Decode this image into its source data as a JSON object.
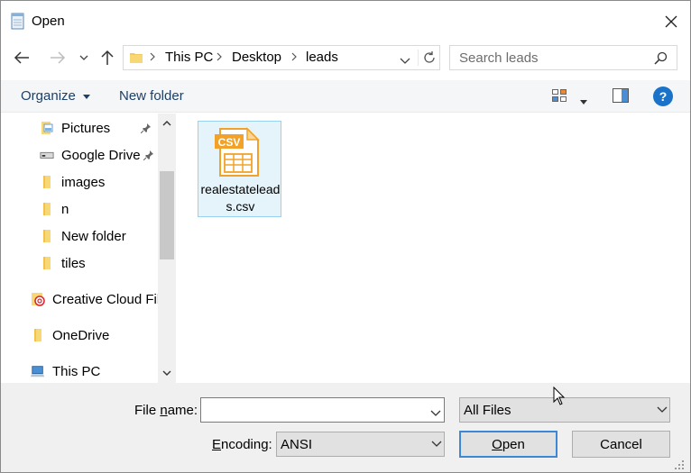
{
  "window": {
    "title": "Open"
  },
  "nav": {
    "breadcrumbs": [
      "This PC",
      "Desktop",
      "leads"
    ],
    "search_placeholder": "Search leads"
  },
  "toolbar": {
    "organize": "Organize",
    "new_folder": "New folder",
    "help": "?"
  },
  "tree": [
    {
      "label": "Pictures",
      "icon": "pictures-folder-icon",
      "pinned": true
    },
    {
      "label": "Google Drive",
      "icon": "drive-icon",
      "pinned": true
    },
    {
      "label": "images",
      "icon": "folder-icon"
    },
    {
      "label": "n",
      "icon": "folder-icon"
    },
    {
      "label": "New folder",
      "icon": "folder-icon"
    },
    {
      "label": "tiles",
      "icon": "folder-icon"
    },
    {
      "label": "Creative Cloud Files",
      "icon": "creative-cloud-icon"
    },
    {
      "label": "OneDrive",
      "icon": "folder-icon"
    },
    {
      "label": "This PC",
      "icon": "computer-icon"
    }
  ],
  "files": [
    {
      "name": "realestateleads.csv",
      "icon_text": "CSV",
      "icon": "csv-file-icon",
      "selected": true
    }
  ],
  "bottom": {
    "file_name_label_pre": "File ",
    "file_name_label_u": "n",
    "file_name_label_post": "ame:",
    "file_name_value": "",
    "file_type": "All Files",
    "encoding_label_u": "E",
    "encoding_label_post": "ncoding:",
    "encoding": "ANSI",
    "open_label_u": "O",
    "open_label_post": "pen",
    "cancel": "Cancel"
  },
  "colors": {
    "accent": "#1a73c9",
    "selection": "#e5f3fb",
    "csv_orange": "#f2a229"
  }
}
